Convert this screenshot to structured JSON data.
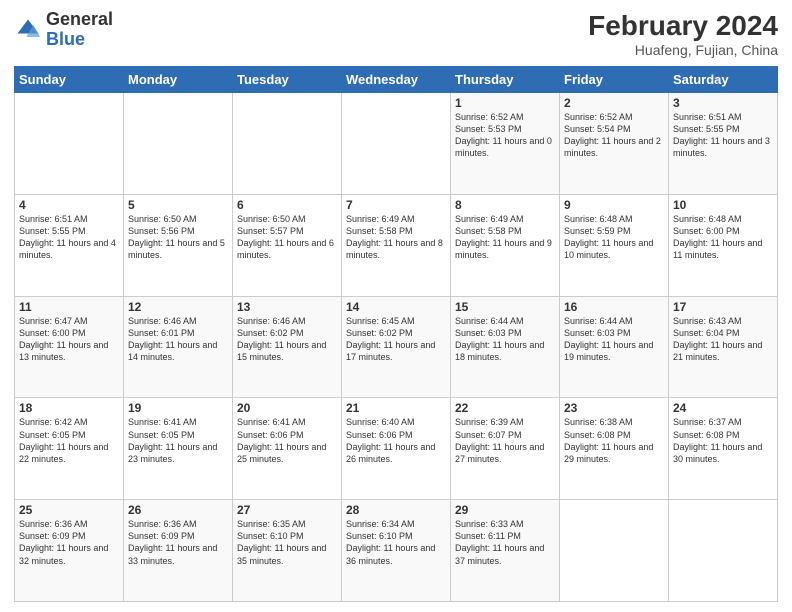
{
  "header": {
    "logo_general": "General",
    "logo_blue": "Blue",
    "month_year": "February 2024",
    "location": "Huafeng, Fujian, China"
  },
  "days_of_week": [
    "Sunday",
    "Monday",
    "Tuesday",
    "Wednesday",
    "Thursday",
    "Friday",
    "Saturday"
  ],
  "weeks": [
    [
      {
        "day": "",
        "info": ""
      },
      {
        "day": "",
        "info": ""
      },
      {
        "day": "",
        "info": ""
      },
      {
        "day": "",
        "info": ""
      },
      {
        "day": "1",
        "info": "Sunrise: 6:52 AM\nSunset: 5:53 PM\nDaylight: 11 hours and 0 minutes."
      },
      {
        "day": "2",
        "info": "Sunrise: 6:52 AM\nSunset: 5:54 PM\nDaylight: 11 hours and 2 minutes."
      },
      {
        "day": "3",
        "info": "Sunrise: 6:51 AM\nSunset: 5:55 PM\nDaylight: 11 hours and 3 minutes."
      }
    ],
    [
      {
        "day": "4",
        "info": "Sunrise: 6:51 AM\nSunset: 5:55 PM\nDaylight: 11 hours and 4 minutes."
      },
      {
        "day": "5",
        "info": "Sunrise: 6:50 AM\nSunset: 5:56 PM\nDaylight: 11 hours and 5 minutes."
      },
      {
        "day": "6",
        "info": "Sunrise: 6:50 AM\nSunset: 5:57 PM\nDaylight: 11 hours and 6 minutes."
      },
      {
        "day": "7",
        "info": "Sunrise: 6:49 AM\nSunset: 5:58 PM\nDaylight: 11 hours and 8 minutes."
      },
      {
        "day": "8",
        "info": "Sunrise: 6:49 AM\nSunset: 5:58 PM\nDaylight: 11 hours and 9 minutes."
      },
      {
        "day": "9",
        "info": "Sunrise: 6:48 AM\nSunset: 5:59 PM\nDaylight: 11 hours and 10 minutes."
      },
      {
        "day": "10",
        "info": "Sunrise: 6:48 AM\nSunset: 6:00 PM\nDaylight: 11 hours and 11 minutes."
      }
    ],
    [
      {
        "day": "11",
        "info": "Sunrise: 6:47 AM\nSunset: 6:00 PM\nDaylight: 11 hours and 13 minutes."
      },
      {
        "day": "12",
        "info": "Sunrise: 6:46 AM\nSunset: 6:01 PM\nDaylight: 11 hours and 14 minutes."
      },
      {
        "day": "13",
        "info": "Sunrise: 6:46 AM\nSunset: 6:02 PM\nDaylight: 11 hours and 15 minutes."
      },
      {
        "day": "14",
        "info": "Sunrise: 6:45 AM\nSunset: 6:02 PM\nDaylight: 11 hours and 17 minutes."
      },
      {
        "day": "15",
        "info": "Sunrise: 6:44 AM\nSunset: 6:03 PM\nDaylight: 11 hours and 18 minutes."
      },
      {
        "day": "16",
        "info": "Sunrise: 6:44 AM\nSunset: 6:03 PM\nDaylight: 11 hours and 19 minutes."
      },
      {
        "day": "17",
        "info": "Sunrise: 6:43 AM\nSunset: 6:04 PM\nDaylight: 11 hours and 21 minutes."
      }
    ],
    [
      {
        "day": "18",
        "info": "Sunrise: 6:42 AM\nSunset: 6:05 PM\nDaylight: 11 hours and 22 minutes."
      },
      {
        "day": "19",
        "info": "Sunrise: 6:41 AM\nSunset: 6:05 PM\nDaylight: 11 hours and 23 minutes."
      },
      {
        "day": "20",
        "info": "Sunrise: 6:41 AM\nSunset: 6:06 PM\nDaylight: 11 hours and 25 minutes."
      },
      {
        "day": "21",
        "info": "Sunrise: 6:40 AM\nSunset: 6:06 PM\nDaylight: 11 hours and 26 minutes."
      },
      {
        "day": "22",
        "info": "Sunrise: 6:39 AM\nSunset: 6:07 PM\nDaylight: 11 hours and 27 minutes."
      },
      {
        "day": "23",
        "info": "Sunrise: 6:38 AM\nSunset: 6:08 PM\nDaylight: 11 hours and 29 minutes."
      },
      {
        "day": "24",
        "info": "Sunrise: 6:37 AM\nSunset: 6:08 PM\nDaylight: 11 hours and 30 minutes."
      }
    ],
    [
      {
        "day": "25",
        "info": "Sunrise: 6:36 AM\nSunset: 6:09 PM\nDaylight: 11 hours and 32 minutes."
      },
      {
        "day": "26",
        "info": "Sunrise: 6:36 AM\nSunset: 6:09 PM\nDaylight: 11 hours and 33 minutes."
      },
      {
        "day": "27",
        "info": "Sunrise: 6:35 AM\nSunset: 6:10 PM\nDaylight: 11 hours and 35 minutes."
      },
      {
        "day": "28",
        "info": "Sunrise: 6:34 AM\nSunset: 6:10 PM\nDaylight: 11 hours and 36 minutes."
      },
      {
        "day": "29",
        "info": "Sunrise: 6:33 AM\nSunset: 6:11 PM\nDaylight: 11 hours and 37 minutes."
      },
      {
        "day": "",
        "info": ""
      },
      {
        "day": "",
        "info": ""
      }
    ]
  ]
}
